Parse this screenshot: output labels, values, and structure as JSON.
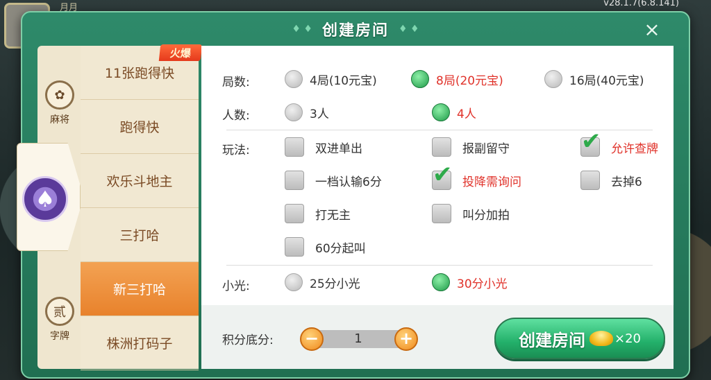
{
  "version": "v28.1.7(6.8.141)",
  "bg_text": "月月",
  "dialog": {
    "title": "创建房间",
    "close_icon": "×"
  },
  "categories": [
    {
      "label": "麻将",
      "icon": "mahjong-icon"
    },
    {
      "label": "",
      "icon": "spade-icon"
    },
    {
      "label": "字牌",
      "badge_char": "贰",
      "icon": "zipai-icon"
    }
  ],
  "games": [
    {
      "label": "11张跑得快",
      "active": false
    },
    {
      "label": "跑得快",
      "active": false
    },
    {
      "label": "欢乐斗地主",
      "active": false
    },
    {
      "label": "三打哈",
      "active": false
    },
    {
      "label": "新三打哈",
      "active": true
    },
    {
      "label": "株洲打码子",
      "active": false
    }
  ],
  "hot_tag": "火爆",
  "rounds": {
    "label": "局数:",
    "options": [
      "4局(10元宝)",
      "8局(20元宝)",
      "16局(40元宝)"
    ],
    "selected": 1
  },
  "players": {
    "label": "人数:",
    "options": [
      "3人",
      "4人"
    ],
    "selected": 1
  },
  "rules": {
    "label": "玩法:",
    "items": [
      {
        "label": "双进单出",
        "checked": false
      },
      {
        "label": "报副留守",
        "checked": false
      },
      {
        "label": "允许查牌",
        "checked": true
      },
      {
        "label": "一档认输6分",
        "checked": false
      },
      {
        "label": "投降需询问",
        "checked": true
      },
      {
        "label": "去掉6",
        "checked": false
      },
      {
        "label": "打无主",
        "checked": false
      },
      {
        "label": "叫分加拍",
        "checked": false
      },
      {
        "label": "60分起叫",
        "checked": false
      }
    ]
  },
  "xiaoguang": {
    "label": "小光:",
    "options": [
      "25分小光",
      "30分小光"
    ],
    "selected": 1
  },
  "score": {
    "label": "积分底分:",
    "value": "1",
    "minus": "−",
    "plus": "+"
  },
  "create": {
    "label": "创建房间",
    "cost": "×20"
  }
}
